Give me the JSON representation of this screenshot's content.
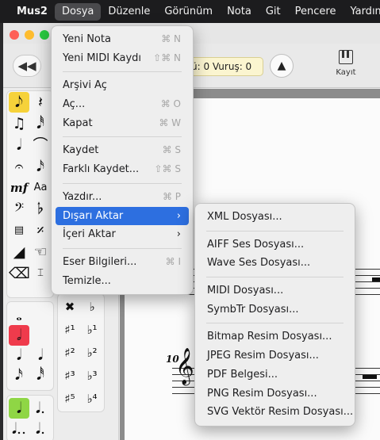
{
  "menubar": {
    "app": "Mus2",
    "items": [
      "Dosya",
      "Düzenle",
      "Görünüm",
      "Nota",
      "Git",
      "Pencere",
      "Yardım"
    ],
    "active": "Dosya"
  },
  "toolbar": {
    "position_text": "ü: 0 Vuruş: 0",
    "record_label": "Kayıt"
  },
  "score": {
    "measure_number": "10"
  },
  "file_menu": {
    "groups": [
      [
        {
          "label": "Yeni Nota",
          "shortcut": "⌘ N"
        },
        {
          "label": "Yeni MIDI Kaydı",
          "shortcut": "⇧⌘ N"
        }
      ],
      [
        {
          "label": "Arşivi Aç",
          "shortcut": ""
        },
        {
          "label": "Aç...",
          "shortcut": "⌘ O"
        },
        {
          "label": "Kapat",
          "shortcut": "⌘ W"
        }
      ],
      [
        {
          "label": "Kaydet",
          "shortcut": "⌘ S"
        },
        {
          "label": "Farklı Kaydet...",
          "shortcut": "⇧⌘ S"
        }
      ],
      [
        {
          "label": "Yazdır...",
          "shortcut": "⌘ P"
        },
        {
          "label": "Dışarı Aktar",
          "shortcut": "",
          "submenu": true,
          "highlighted": true
        },
        {
          "label": "İçeri Aktar",
          "shortcut": "",
          "submenu": true
        }
      ],
      [
        {
          "label": "Eser Bilgileri...",
          "shortcut": "⌘ I"
        },
        {
          "label": "Temizle...",
          "shortcut": ""
        }
      ]
    ]
  },
  "export_submenu": {
    "groups": [
      [
        "XML Dosyası..."
      ],
      [
        "AIFF Ses Dosyası...",
        "Wave Ses Dosyası..."
      ],
      [
        "MIDI Dosyası...",
        "SymbTr Dosyası..."
      ],
      [
        "Bitmap Resim Dosyası...",
        "JPEG Resim Dosyası...",
        "PDF Belgesi...",
        "PNG Resim Dosyası...",
        "SVG Vektör Resim Dosyası..."
      ]
    ]
  },
  "palette": {
    "rows": [
      [
        "𝅘𝅥𝅮",
        "𝄽"
      ],
      [
        "♫",
        "𝅘𝅥𝅰"
      ],
      [
        "𝅘𝅥",
        "⌒"
      ],
      [
        "𝄐",
        "𝅘𝅥𝅯"
      ],
      [
        "mf",
        "Aa"
      ],
      [
        "𝄢",
        "𝄬"
      ],
      [
        "▤",
        "𝄎"
      ],
      [
        "◢",
        "☜"
      ],
      [
        "⌫",
        "⌶"
      ]
    ],
    "row_colors": [
      [
        "#f6d23a",
        ""
      ],
      [
        "",
        ""
      ],
      [
        "",
        ""
      ],
      [
        "",
        ""
      ],
      [
        "",
        ""
      ],
      [
        "",
        ""
      ],
      [
        "",
        ""
      ],
      [
        "",
        ""
      ],
      [
        "",
        ""
      ]
    ],
    "accidentals": [
      [
        "✖",
        "♭"
      ],
      [
        "♯¹",
        "♭¹"
      ],
      [
        "♯²",
        "♭²"
      ],
      [
        "♯³",
        "♭³"
      ],
      [
        "♯⁵",
        "♭⁴"
      ]
    ],
    "duration_col": [
      "𝅝",
      "𝅗𝅥",
      "𝅘𝅥",
      "𝅘𝅥𝅮",
      "𝅘𝅥𝅯"
    ],
    "dotted_col": [
      "𝅘𝅥",
      "𝅘𝅥."
    ]
  }
}
